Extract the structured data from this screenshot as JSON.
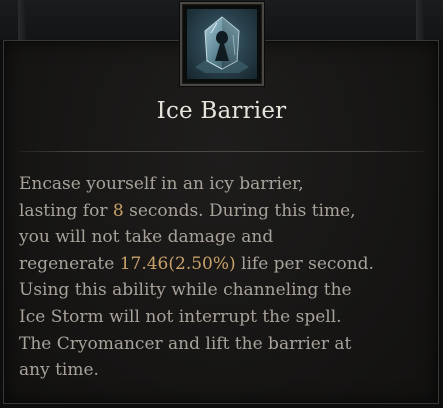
{
  "skill": {
    "name": "Ice Barrier",
    "icon": "ice-barrier-crystal-icon",
    "description_lines": [
      [
        {
          "text": "Encase yourself in an icy barrier,"
        }
      ],
      [
        {
          "text": "lasting for "
        },
        {
          "text": "8",
          "highlight": true
        },
        {
          "text": " seconds. During this time,"
        }
      ],
      [
        {
          "text": "you will not take damage and"
        }
      ],
      [
        {
          "text": "regenerate "
        },
        {
          "text": "17.46(2.50%)",
          "highlight": true
        },
        {
          "text": " life per second."
        }
      ],
      [
        {
          "text": "Using this ability while channeling the"
        }
      ],
      [
        {
          "text": "Ice Storm will not interrupt the spell."
        }
      ],
      [
        {
          "text": "The Cryomancer and lift the barrier at"
        }
      ],
      [
        {
          "text": "any time."
        }
      ]
    ]
  },
  "colors": {
    "title": "#e8e4dc",
    "body_text": "#a8a29a",
    "highlight": "#c8a16a",
    "panel_background": "#171615",
    "panel_border": "#3a3835"
  }
}
